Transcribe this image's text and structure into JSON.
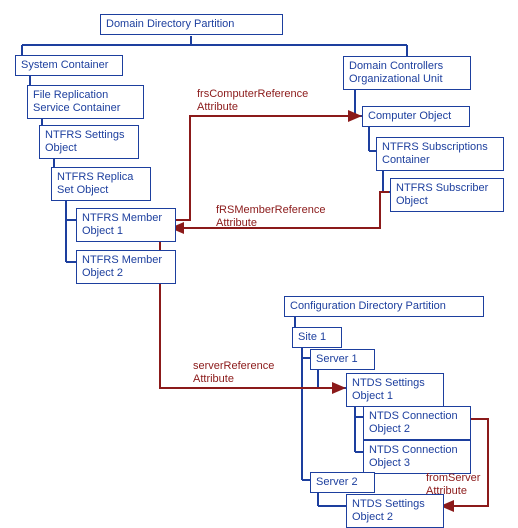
{
  "boxes": {
    "domain_dir": "Domain Directory Partition",
    "system_container": "System Container",
    "frs_container": "File Replication\nService Container",
    "ntfrs_settings": "NTFRS Settings\nObject",
    "ntfrs_replica": "NTFRS Replica\nSet Object",
    "ntfrs_member1": "NTFRS Member\nObject 1",
    "ntfrs_member2": "NTFRS Member\nObject 2",
    "dc_ou": "Domain Controllers\nOrganizational Unit",
    "computer_obj": "Computer Object",
    "ntfrs_subs_container": "NTFRS Subscriptions\nContainer",
    "ntfrs_subscriber": "NTFRS Subscriber\nObject",
    "config_partition": "Configuration Directory Partition",
    "site1": "Site 1",
    "server1": "Server 1",
    "ntds_settings1": "NTDS Settings\nObject 1",
    "ntds_conn2": "NTDS Connection\nObject 2",
    "ntds_conn3": "NTDS Connection\nObject 3",
    "server2": "Server 2",
    "ntds_settings2": "NTDS Settings\nObject 2"
  },
  "labels": {
    "frs_computer_ref": "frsComputerReference\nAttribute",
    "frs_member_ref": "fRSMemberReference\nAttribute",
    "server_ref": "serverReference\nAttribute",
    "from_server": "fromServer\nAttribute"
  }
}
